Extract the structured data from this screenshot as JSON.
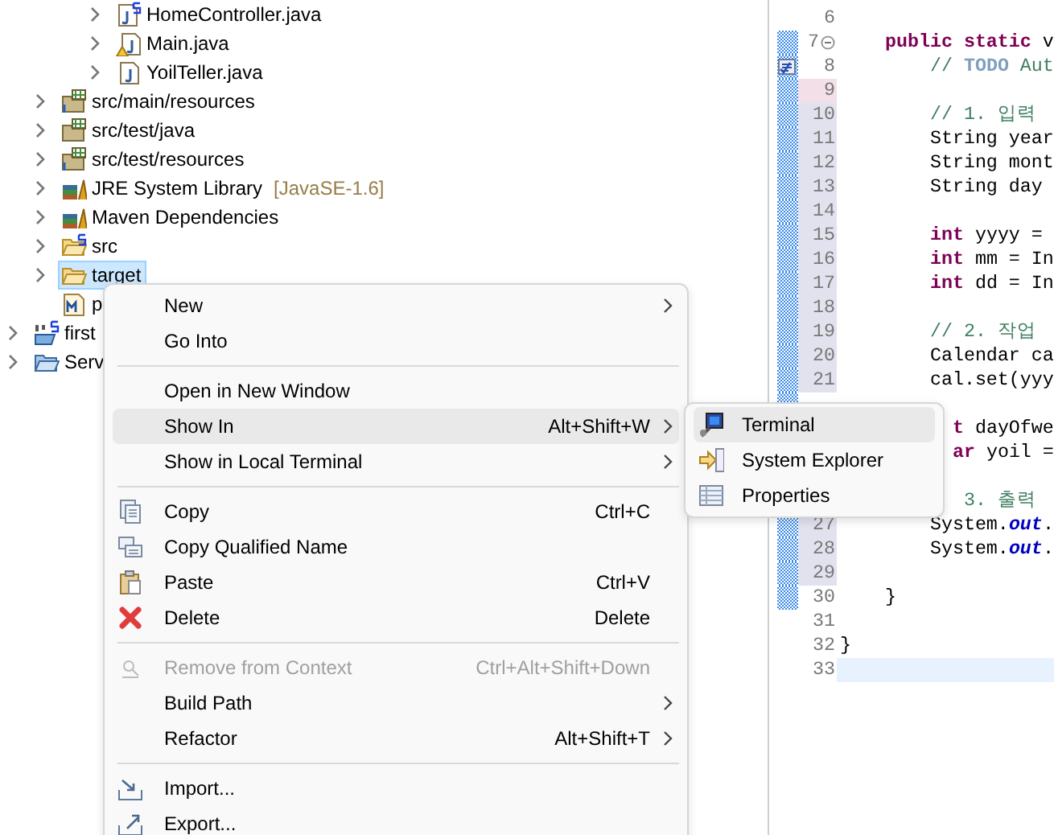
{
  "tree": [
    {
      "children": [
        {
          "children": [
            {
              "children": [
                {
                  "label": "HomeController.java",
                  "kind": "spring-java-file",
                  "expanded": false,
                  "selected": false
                },
                {
                  "label": "Main.java",
                  "kind": "warning-java-file",
                  "expanded": false,
                  "selected": false
                },
                {
                  "label": "YoilTeller.java",
                  "kind": "java-file",
                  "expanded": false,
                  "selected": false
                }
              ]
            }
          ]
        },
        {
          "label": "src/main/resources",
          "kind": "resource-folder",
          "expanded": false,
          "selected": false
        },
        {
          "label": "src/test/java",
          "kind": "source-folder",
          "expanded": false,
          "selected": false
        },
        {
          "label": "src/test/resources",
          "kind": "resource-folder",
          "expanded": false,
          "selected": false
        },
        {
          "label": "JRE System Library",
          "decoration": "[JavaSE-1.6]",
          "kind": "library",
          "expanded": false,
          "selected": false
        },
        {
          "label": "Maven Dependencies",
          "kind": "library",
          "expanded": false,
          "selected": false
        },
        {
          "label": "src",
          "kind": "spring-folder",
          "expanded": false,
          "selected": false
        },
        {
          "label": "target",
          "kind": "folder",
          "expanded": false,
          "selected": true
        },
        {
          "label": "p",
          "kind": "maven-file",
          "selected": false
        }
      ]
    },
    {
      "label": "first",
      "kind": "spring-project",
      "expanded": false,
      "selected": false
    },
    {
      "label": "Serv",
      "kind": "folder-project",
      "expanded": false,
      "selected": false
    }
  ],
  "editor": {
    "lines": [
      {
        "kind": "code",
        "number": "6",
        "bar": false,
        "changed": false,
        "added": false
      },
      {
        "kind": "code",
        "number": "7",
        "bar": true,
        "changed": false,
        "added": false,
        "fold": true,
        "segments": [
          {
            "kind": "keyword",
            "text": "    public static"
          },
          {
            "kind": "plain",
            "text": " v"
          }
        ]
      },
      {
        "kind": "code",
        "number": "8",
        "bar": true,
        "changed": false,
        "added": false,
        "task": true,
        "segments": [
          {
            "kind": "comment",
            "text": "        // "
          },
          {
            "kind": "task",
            "text": "TODO"
          },
          {
            "kind": "comment",
            "text": " Aut"
          }
        ]
      },
      {
        "kind": "code",
        "number": "9",
        "bar": true,
        "changed": false,
        "added": true
      },
      {
        "kind": "code",
        "number": "10",
        "bar": true,
        "changed": true,
        "added": false,
        "segments": [
          {
            "kind": "comment",
            "text": "        // 1. 입력"
          }
        ]
      },
      {
        "kind": "code",
        "number": "11",
        "bar": true,
        "changed": true,
        "added": false,
        "segments": [
          {
            "kind": "plain",
            "text": "        String year"
          }
        ]
      },
      {
        "kind": "code",
        "number": "12",
        "bar": true,
        "changed": true,
        "added": false,
        "segments": [
          {
            "kind": "plain",
            "text": "        String mont"
          }
        ]
      },
      {
        "kind": "code",
        "number": "13",
        "bar": true,
        "changed": true,
        "added": false,
        "segments": [
          {
            "kind": "plain",
            "text": "        String day"
          }
        ]
      },
      {
        "kind": "code",
        "number": "14",
        "bar": true,
        "changed": true,
        "added": false
      },
      {
        "kind": "code",
        "number": "15",
        "bar": true,
        "changed": true,
        "added": false,
        "segments": [
          {
            "kind": "keyword",
            "text": "        int"
          },
          {
            "kind": "plain",
            "text": " yyyy ="
          }
        ]
      },
      {
        "kind": "code",
        "number": "16",
        "bar": true,
        "changed": true,
        "added": false,
        "segments": [
          {
            "kind": "keyword",
            "text": "        int"
          },
          {
            "kind": "plain",
            "text": " mm = In"
          }
        ]
      },
      {
        "kind": "code",
        "number": "17",
        "bar": true,
        "changed": true,
        "added": false,
        "segments": [
          {
            "kind": "keyword",
            "text": "        int"
          },
          {
            "kind": "plain",
            "text": " dd = In"
          }
        ]
      },
      {
        "kind": "code",
        "number": "18",
        "bar": true,
        "changed": true,
        "added": false
      },
      {
        "kind": "code",
        "number": "19",
        "bar": true,
        "changed": true,
        "added": false,
        "segments": [
          {
            "kind": "comment",
            "text": "        // 2. 작업"
          }
        ]
      },
      {
        "kind": "code",
        "number": "20",
        "bar": true,
        "changed": true,
        "added": false,
        "segments": [
          {
            "kind": "plain",
            "text": "        Calendar ca"
          }
        ]
      },
      {
        "kind": "code",
        "number": "21",
        "bar": true,
        "changed": true,
        "added": false,
        "segments": [
          {
            "kind": "plain",
            "text": "        cal.set(yyy"
          }
        ]
      },
      {
        "kind": "code",
        "bar": true
      },
      {
        "kind": "code",
        "segments": [
          {
            "kind": "keyword",
            "text": "          t"
          },
          {
            "kind": "plain",
            "text": " dayOfwe"
          }
        ]
      },
      {
        "kind": "code",
        "segments": [
          {
            "kind": "keyword",
            "text": "          ar"
          },
          {
            "kind": "plain",
            "text": " yoil ="
          }
        ]
      },
      {
        "kind": "blank"
      },
      {
        "kind": "code",
        "segments": [
          {
            "kind": "comment",
            "text": "           3. 출력"
          }
        ]
      },
      {
        "kind": "code",
        "number": "27",
        "bar": true,
        "changed": true,
        "added": false,
        "segments": [
          {
            "kind": "plain",
            "text": "        System."
          },
          {
            "kind": "field",
            "text": "out"
          },
          {
            "kind": "plain",
            "text": "."
          }
        ]
      },
      {
        "kind": "code",
        "number": "28",
        "bar": true,
        "changed": true,
        "added": false,
        "segments": [
          {
            "kind": "plain",
            "text": "        System."
          },
          {
            "kind": "field",
            "text": "out"
          },
          {
            "kind": "plain",
            "text": "."
          }
        ]
      },
      {
        "kind": "code",
        "number": "29",
        "bar": true,
        "changed": true,
        "added": false
      },
      {
        "kind": "code",
        "number": "30",
        "bar": true,
        "changed": false,
        "added": false,
        "segments": [
          {
            "kind": "plain",
            "text": "    }"
          }
        ]
      },
      {
        "kind": "code",
        "number": "31",
        "bar": false,
        "changed": false,
        "added": false
      },
      {
        "kind": "code",
        "number": "32",
        "bar": false,
        "changed": false,
        "added": false,
        "segments": [
          {
            "kind": "plain",
            "text": "}"
          }
        ]
      },
      {
        "kind": "code",
        "number": "33",
        "bar": false,
        "changed": false,
        "added": false,
        "current": true
      }
    ]
  },
  "context_menu": {
    "items": [
      {
        "kind": "command",
        "label": "New",
        "submenu": true,
        "disabled": false,
        "selected": false
      },
      {
        "kind": "command",
        "label": "Go Into",
        "submenu": false,
        "disabled": false,
        "selected": false
      },
      {
        "kind": "separator"
      },
      {
        "kind": "command",
        "label": "Open in New Window",
        "submenu": false,
        "disabled": false,
        "selected": false
      },
      {
        "kind": "command",
        "label": "Show In",
        "shortcut": "Alt+Shift+W",
        "submenu": true,
        "disabled": false,
        "selected": true
      },
      {
        "kind": "command",
        "label": "Show in Local Terminal",
        "submenu": true,
        "disabled": false,
        "selected": false
      },
      {
        "kind": "separator"
      },
      {
        "kind": "command",
        "label": "Copy",
        "shortcut": "Ctrl+C",
        "submenu": false,
        "disabled": false,
        "selected": false
      },
      {
        "kind": "command",
        "label": "Copy Qualified Name",
        "submenu": false,
        "disabled": false,
        "selected": false
      },
      {
        "kind": "command",
        "label": "Paste",
        "shortcut": "Ctrl+V",
        "submenu": false,
        "disabled": false,
        "selected": false
      },
      {
        "kind": "command",
        "label": "Delete",
        "shortcut": "Delete",
        "submenu": false,
        "disabled": false,
        "selected": false
      },
      {
        "kind": "separator"
      },
      {
        "kind": "command",
        "label": "Remove from Context",
        "shortcut": "Ctrl+Alt+Shift+Down",
        "submenu": false,
        "disabled": true,
        "selected": false
      },
      {
        "kind": "command",
        "label": "Build Path",
        "submenu": true,
        "disabled": false,
        "selected": false
      },
      {
        "kind": "command",
        "label": "Refactor",
        "shortcut": "Alt+Shift+T",
        "submenu": true,
        "disabled": false,
        "selected": false
      },
      {
        "kind": "separator"
      },
      {
        "kind": "command",
        "label": "Import...",
        "submenu": false,
        "disabled": false,
        "selected": false
      },
      {
        "kind": "command",
        "label": "Export...",
        "submenu": false,
        "disabled": false,
        "selected": false
      }
    ]
  },
  "submenu": {
    "items": [
      {
        "label": "Terminal",
        "selected": true
      },
      {
        "label": "System Explorer",
        "selected": false
      },
      {
        "label": "Properties",
        "selected": false
      }
    ]
  }
}
